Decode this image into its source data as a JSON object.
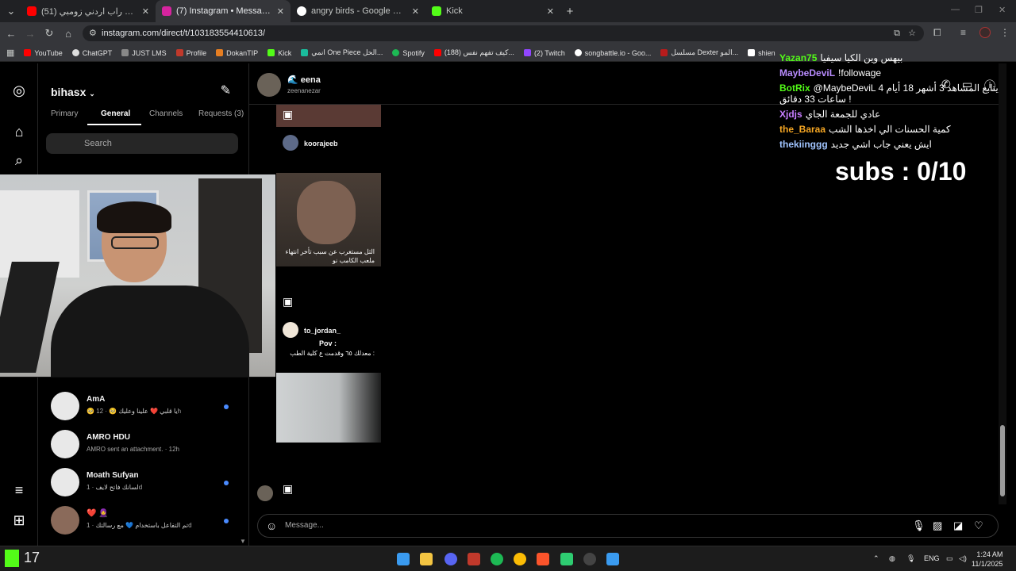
{
  "colors": {
    "chrome_bg": "#202124",
    "toolbar_bg": "#35363a",
    "ig_bg": "#000000",
    "unread_dot": "#4a8bff",
    "kick_green": "#53fc18"
  },
  "browser": {
    "tabs": [
      {
        "title": "(51) راب الأردن راب اردني زومبي",
        "icon": "youtube-icon",
        "color": "#ff0000"
      },
      {
        "title": "(7) Instagram • Messages",
        "icon": "instagram-icon",
        "color": "#d6249f"
      },
      {
        "title": "angry birds - Google Search",
        "icon": "google-icon",
        "color": "#ffffff"
      },
      {
        "title": "Kick",
        "icon": "kick-icon",
        "color": "#53fc18"
      }
    ],
    "url": "instagram.com/direct/t/103183554410613/",
    "bookmarks": [
      {
        "label": "YouTube",
        "color": "#ff0000"
      },
      {
        "label": "ChatGPT",
        "color": "#dddddd"
      },
      {
        "label": "JUST LMS",
        "color": "#888888"
      },
      {
        "label": "Profile",
        "color": "#c0392b"
      },
      {
        "label": "DokanTIP",
        "color": "#e67e22"
      },
      {
        "label": "Kick",
        "color": "#53fc18"
      },
      {
        "label": "انمي One Piece الحل...",
        "color": "#1abc9c"
      },
      {
        "label": "Spotify",
        "color": "#1db954"
      },
      {
        "label": "(188) كيف تفهم نفس...",
        "color": "#ff0000"
      },
      {
        "label": "(2) Twitch",
        "color": "#9146ff"
      },
      {
        "label": "songbattle.io - Goo...",
        "color": "#ffffff"
      },
      {
        "label": "مسلسل Dexter المو...",
        "color": "#b71c1c"
      },
      {
        "label": "shien",
        "color": "#ffffff"
      }
    ]
  },
  "inbox": {
    "username": "bihasx",
    "tabs": [
      "Primary",
      "General",
      "Channels",
      "Requests (3)"
    ],
    "search_placeholder": "Search",
    "conversations": [
      {
        "name": "AmA",
        "preview": "🥺 يا قلبي ❤️ علينا وعليك 🥺",
        "meta": "· 12h",
        "unread": true
      },
      {
        "name": "AMRO HDU",
        "preview": "AMRO sent an attachment.",
        "meta": "· 12h",
        "unread": false
      },
      {
        "name": "Moath Sufyan",
        "preview": "لسانك فاتح لايف",
        "meta": "· 1d",
        "unread": true
      },
      {
        "name": "❤️ 🧕",
        "preview": "تم التفاعل باستخدام 💙 مع رسالتك",
        "meta": "· 1d",
        "unread": true
      }
    ]
  },
  "thread": {
    "name": "🌊 eena",
    "handle": "zeenanezar",
    "messages": [
      {
        "sender": "koorajeeb",
        "caption": "الثل مستغرب عن سبب تأخر انتهاء ملعب الكامب نو"
      },
      {
        "sender": "to_jordan_",
        "caption_title": "Pov :",
        "caption": "معدلك ٦٥ وقدمت ع كلية الطب :"
      }
    ],
    "message_placeholder": "Message..."
  },
  "stream_chat": [
    {
      "user": "Yazan75",
      "color": "#53fc18",
      "text": "بيهس وين الكيا سيفيا"
    },
    {
      "user": "MaybeDeviL",
      "color": "#b98cff",
      "text": "!followage"
    },
    {
      "user": "BotRix",
      "color": "#53fc18",
      "text": "@MaybeDeviL 4 يتابع المشاهد 3 أشهر 18 أيام"
    },
    {
      "user": "",
      "color": "#ffffff",
      "text": "ساعات 33 دقائق !"
    },
    {
      "user": "Xjdjs",
      "color": "#c77dff",
      "text": "عادي للجمعة الجاي"
    },
    {
      "user": "the_Baraa",
      "color": "#f5a623",
      "text": "كمية الحسنات الي اخذها الشب"
    },
    {
      "user": "thekiinggg",
      "color": "#a0c4ff",
      "text": "ايش يعني جاب اشي جديد"
    }
  ],
  "subs_goal": "subs : 0/10",
  "taskbar": {
    "kick_count": "17",
    "language": "ENG",
    "time": "1:24 AM",
    "date": "11/1/2025"
  }
}
